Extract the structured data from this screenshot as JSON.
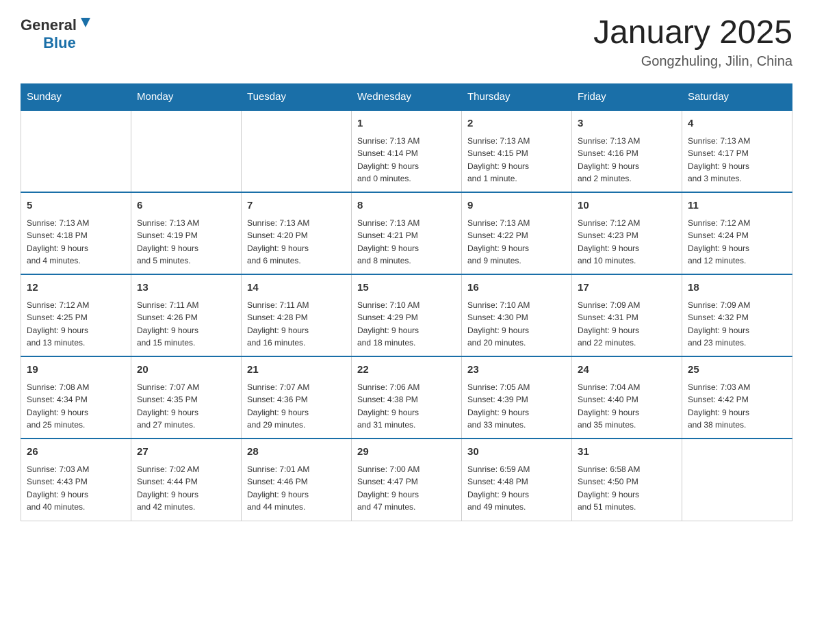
{
  "logo": {
    "text_general": "General",
    "text_blue": "Blue",
    "arrow_symbol": "▲"
  },
  "header": {
    "title": "January 2025",
    "subtitle": "Gongzhuling, Jilin, China"
  },
  "weekdays": [
    "Sunday",
    "Monday",
    "Tuesday",
    "Wednesday",
    "Thursday",
    "Friday",
    "Saturday"
  ],
  "weeks": [
    [
      {
        "day": "",
        "info": ""
      },
      {
        "day": "",
        "info": ""
      },
      {
        "day": "",
        "info": ""
      },
      {
        "day": "1",
        "info": "Sunrise: 7:13 AM\nSunset: 4:14 PM\nDaylight: 9 hours\nand 0 minutes."
      },
      {
        "day": "2",
        "info": "Sunrise: 7:13 AM\nSunset: 4:15 PM\nDaylight: 9 hours\nand 1 minute."
      },
      {
        "day": "3",
        "info": "Sunrise: 7:13 AM\nSunset: 4:16 PM\nDaylight: 9 hours\nand 2 minutes."
      },
      {
        "day": "4",
        "info": "Sunrise: 7:13 AM\nSunset: 4:17 PM\nDaylight: 9 hours\nand 3 minutes."
      }
    ],
    [
      {
        "day": "5",
        "info": "Sunrise: 7:13 AM\nSunset: 4:18 PM\nDaylight: 9 hours\nand 4 minutes."
      },
      {
        "day": "6",
        "info": "Sunrise: 7:13 AM\nSunset: 4:19 PM\nDaylight: 9 hours\nand 5 minutes."
      },
      {
        "day": "7",
        "info": "Sunrise: 7:13 AM\nSunset: 4:20 PM\nDaylight: 9 hours\nand 6 minutes."
      },
      {
        "day": "8",
        "info": "Sunrise: 7:13 AM\nSunset: 4:21 PM\nDaylight: 9 hours\nand 8 minutes."
      },
      {
        "day": "9",
        "info": "Sunrise: 7:13 AM\nSunset: 4:22 PM\nDaylight: 9 hours\nand 9 minutes."
      },
      {
        "day": "10",
        "info": "Sunrise: 7:12 AM\nSunset: 4:23 PM\nDaylight: 9 hours\nand 10 minutes."
      },
      {
        "day": "11",
        "info": "Sunrise: 7:12 AM\nSunset: 4:24 PM\nDaylight: 9 hours\nand 12 minutes."
      }
    ],
    [
      {
        "day": "12",
        "info": "Sunrise: 7:12 AM\nSunset: 4:25 PM\nDaylight: 9 hours\nand 13 minutes."
      },
      {
        "day": "13",
        "info": "Sunrise: 7:11 AM\nSunset: 4:26 PM\nDaylight: 9 hours\nand 15 minutes."
      },
      {
        "day": "14",
        "info": "Sunrise: 7:11 AM\nSunset: 4:28 PM\nDaylight: 9 hours\nand 16 minutes."
      },
      {
        "day": "15",
        "info": "Sunrise: 7:10 AM\nSunset: 4:29 PM\nDaylight: 9 hours\nand 18 minutes."
      },
      {
        "day": "16",
        "info": "Sunrise: 7:10 AM\nSunset: 4:30 PM\nDaylight: 9 hours\nand 20 minutes."
      },
      {
        "day": "17",
        "info": "Sunrise: 7:09 AM\nSunset: 4:31 PM\nDaylight: 9 hours\nand 22 minutes."
      },
      {
        "day": "18",
        "info": "Sunrise: 7:09 AM\nSunset: 4:32 PM\nDaylight: 9 hours\nand 23 minutes."
      }
    ],
    [
      {
        "day": "19",
        "info": "Sunrise: 7:08 AM\nSunset: 4:34 PM\nDaylight: 9 hours\nand 25 minutes."
      },
      {
        "day": "20",
        "info": "Sunrise: 7:07 AM\nSunset: 4:35 PM\nDaylight: 9 hours\nand 27 minutes."
      },
      {
        "day": "21",
        "info": "Sunrise: 7:07 AM\nSunset: 4:36 PM\nDaylight: 9 hours\nand 29 minutes."
      },
      {
        "day": "22",
        "info": "Sunrise: 7:06 AM\nSunset: 4:38 PM\nDaylight: 9 hours\nand 31 minutes."
      },
      {
        "day": "23",
        "info": "Sunrise: 7:05 AM\nSunset: 4:39 PM\nDaylight: 9 hours\nand 33 minutes."
      },
      {
        "day": "24",
        "info": "Sunrise: 7:04 AM\nSunset: 4:40 PM\nDaylight: 9 hours\nand 35 minutes."
      },
      {
        "day": "25",
        "info": "Sunrise: 7:03 AM\nSunset: 4:42 PM\nDaylight: 9 hours\nand 38 minutes."
      }
    ],
    [
      {
        "day": "26",
        "info": "Sunrise: 7:03 AM\nSunset: 4:43 PM\nDaylight: 9 hours\nand 40 minutes."
      },
      {
        "day": "27",
        "info": "Sunrise: 7:02 AM\nSunset: 4:44 PM\nDaylight: 9 hours\nand 42 minutes."
      },
      {
        "day": "28",
        "info": "Sunrise: 7:01 AM\nSunset: 4:46 PM\nDaylight: 9 hours\nand 44 minutes."
      },
      {
        "day": "29",
        "info": "Sunrise: 7:00 AM\nSunset: 4:47 PM\nDaylight: 9 hours\nand 47 minutes."
      },
      {
        "day": "30",
        "info": "Sunrise: 6:59 AM\nSunset: 4:48 PM\nDaylight: 9 hours\nand 49 minutes."
      },
      {
        "day": "31",
        "info": "Sunrise: 6:58 AM\nSunset: 4:50 PM\nDaylight: 9 hours\nand 51 minutes."
      },
      {
        "day": "",
        "info": ""
      }
    ]
  ]
}
